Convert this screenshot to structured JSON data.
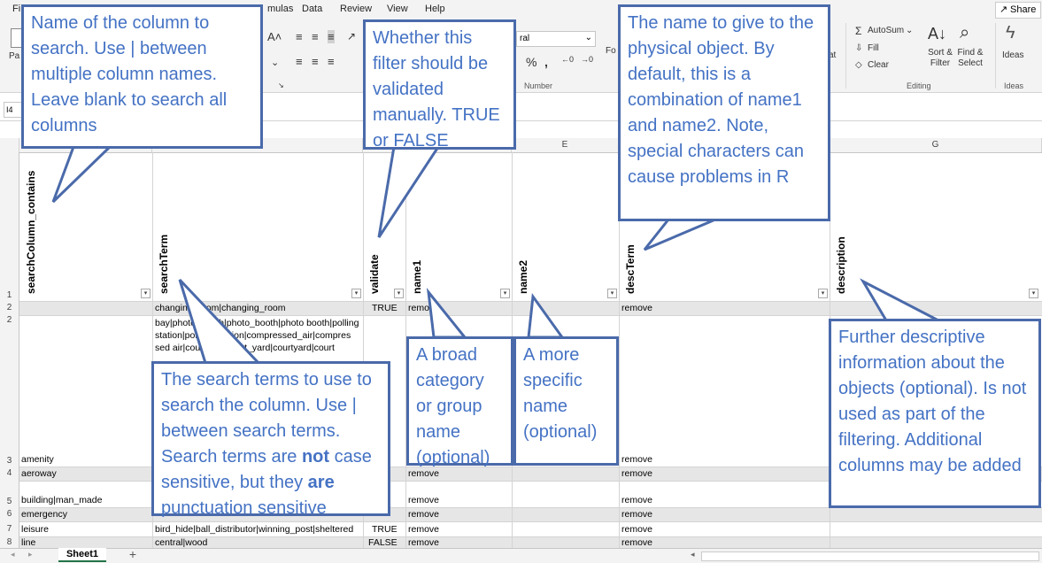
{
  "menu": [
    "Fi",
    "mulas",
    "Data",
    "Review",
    "View",
    "Help"
  ],
  "share_label": "Share",
  "ribbon": {
    "autosum": "AutoSum",
    "fill": "Fill",
    "clear": "Clear",
    "sort_filter": "Sort & Filter",
    "find_select": "Find & Select",
    "ideas": "Ideas",
    "number_format": "ral",
    "group_number": "Number",
    "group_editing": "Editing",
    "group_ideas": "Ideas",
    "frag_pa": "Pa",
    "frag_at": "at",
    "frag_fo": "Fo"
  },
  "name_box": "I4",
  "columns": [
    "E",
    "G"
  ],
  "headers": {
    "searchColumn_contains": "searchColumn_contains",
    "searchTerm": "searchTerm",
    "validate": "validate",
    "name1": "name1",
    "name2": "name2",
    "descTerm": "descTerm",
    "description": "description"
  },
  "rows": {
    "r1": "1",
    "r2": "2",
    "r3": "3",
    "r4": "4",
    "r5": "5",
    "r6": "6",
    "r7": "7",
    "r8": "8"
  },
  "cells": {
    "r2_searchTerm": "changing_room|changing_room",
    "r2_validate": "TRUE",
    "r2_name1": "remove",
    "r2_descTerm": "remove",
    "r3_searchTerm_l1": "bay|photo_booth|photo_booth|photo booth|polling",
    "r3_searchTerm_l2": "station|polling_station|compressed_air|compres",
    "r3_searchTerm_l3": "sed air|courtyard|court_yard|courtyard|court",
    "r3_col": "amenity",
    "r3_descTerm": "remove",
    "r4_col": "aeroway",
    "r4_name1": "remove",
    "r4_descTerm": "remove",
    "r5_col": "building|man_made",
    "r5_name1": "remove",
    "r5_descTerm": "remove",
    "r6_col": "emergency",
    "r6_name1": "remove",
    "r6_descTerm": "remove",
    "r7_col": "leisure",
    "r7_searchTerm": "bird_hide|ball_distributor|winning_post|sheltered",
    "r7_validate": "TRUE",
    "r7_name1": "remove",
    "r7_descTerm": "remove",
    "r8_col": "line",
    "r8_searchTerm": "central|wood",
    "r8_validate": "FALSE",
    "r8_name1": "remove",
    "r8_descTerm": "remove"
  },
  "callouts": {
    "col_search": "Name of the column to search. Use | between multiple column names. Leave blank to search all columns",
    "validate": "Whether this filter should be validated manually. TRUE or FALSE",
    "desc_term": "The name to give to the physical object. By default, this is a combination of name1 and name2. Note, special characters can cause problems in R",
    "name1": "A broad category or group name (optional)",
    "name2": "A more specific name (optional)",
    "description": "Further descriptive information about the objects (optional). Is not used as part of the filtering. Additional columns may be added",
    "search_terms_1": "The search terms to use to search the column. Use | between search terms. Search terms are ",
    "search_terms_not": "not",
    "search_terms_2": " case sensitive, but they ",
    "search_terms_are": "are",
    "search_terms_3": " punctuation sensitive"
  },
  "sheet_tab": "Sheet1",
  "add_sheet": "+",
  "colors": {
    "callout_border": "#4a6aaa",
    "callout_text": "#4472c4",
    "sheet_accent": "#217346"
  }
}
